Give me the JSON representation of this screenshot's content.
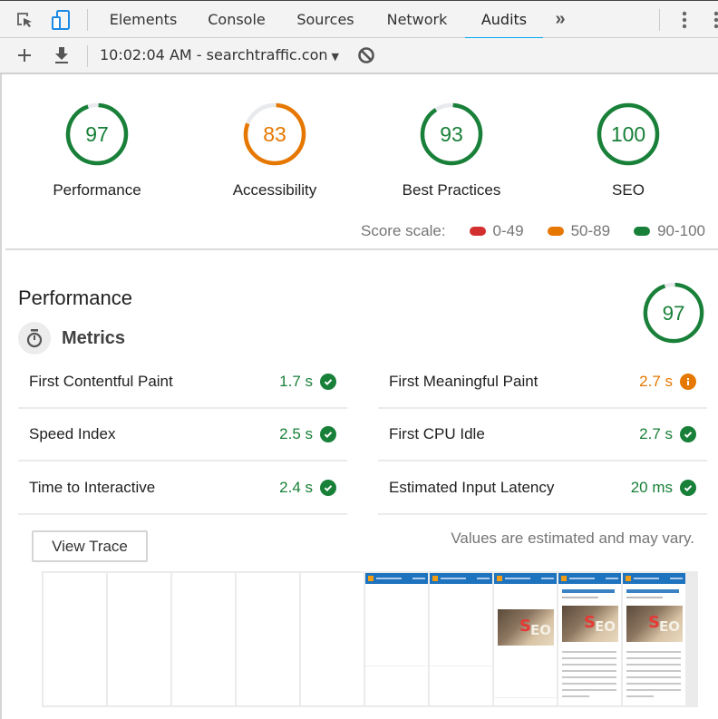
{
  "devtools": {
    "tabs": [
      {
        "label": "Elements",
        "active": false
      },
      {
        "label": "Console",
        "active": false
      },
      {
        "label": "Sources",
        "active": false
      },
      {
        "label": "Network",
        "active": false
      },
      {
        "label": "Audits",
        "active": true
      }
    ],
    "icons": {
      "inspect": "inspect-element-icon",
      "device": "device-toolbar-icon",
      "more_tabs": "chevron-double-right-icon",
      "menu": "more-vert-icon"
    },
    "more_tabs_glyph": "»"
  },
  "toolbar": {
    "report_label": "10:02:04 AM - searchtraffic.con",
    "caret": "▼",
    "icons": [
      "plus-icon",
      "download-icon",
      "clear-icon"
    ]
  },
  "scores": [
    {
      "label": "Performance",
      "value": 97,
      "color": "#188038",
      "category": "pass"
    },
    {
      "label": "Accessibility",
      "value": 83,
      "color": "#e67700",
      "category": "average"
    },
    {
      "label": "Best Practices",
      "value": 93,
      "color": "#188038",
      "category": "pass"
    },
    {
      "label": "SEO",
      "value": 100,
      "color": "#188038",
      "category": "pass"
    }
  ],
  "score_scale": {
    "label": "Score scale:",
    "ranges": [
      {
        "label": "0-49",
        "color": "#d32f2f"
      },
      {
        "label": "50-89",
        "color": "#e67700"
      },
      {
        "label": "90-100",
        "color": "#188038"
      }
    ]
  },
  "performance": {
    "title": "Performance",
    "score": 97,
    "score_color": "#188038",
    "metrics_title": "Metrics",
    "metrics": [
      {
        "name": "First Contentful Paint",
        "value": "1.7 s",
        "status": "pass"
      },
      {
        "name": "First Meaningful Paint",
        "value": "2.7 s",
        "status": "average"
      },
      {
        "name": "Speed Index",
        "value": "2.5 s",
        "status": "pass"
      },
      {
        "name": "First CPU Idle",
        "value": "2.7 s",
        "status": "pass"
      },
      {
        "name": "Time to Interactive",
        "value": "2.4 s",
        "status": "pass"
      },
      {
        "name": "Estimated Input Latency",
        "value": "20 ms",
        "status": "pass"
      }
    ],
    "view_trace_label": "View Trace",
    "disclaimer": "Values are estimated and may vary.",
    "filmstrip": [
      {
        "state": "blank"
      },
      {
        "state": "blank"
      },
      {
        "state": "blank"
      },
      {
        "state": "blank"
      },
      {
        "state": "blank"
      },
      {
        "state": "header"
      },
      {
        "state": "header"
      },
      {
        "state": "image"
      },
      {
        "state": "full"
      },
      {
        "state": "full"
      }
    ]
  },
  "colors": {
    "pass": "#188038",
    "average": "#e67700",
    "fail": "#d32f2f",
    "accent_tab": "#03a9f4"
  }
}
